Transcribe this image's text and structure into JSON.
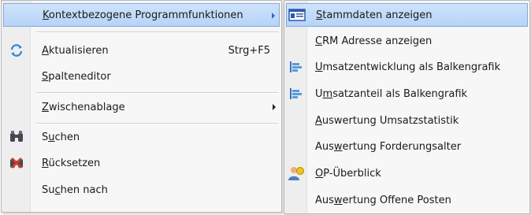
{
  "left_menu": {
    "items": [
      {
        "pre": "",
        "key": "K",
        "post": "ontextbezogene Programmfunktionen"
      },
      {
        "pre": "",
        "key": "A",
        "post": "ktualisieren",
        "shortcut": "Strg+F5",
        "icon": "refresh-icon"
      },
      {
        "pre": "",
        "key": "S",
        "post": "palteneditor"
      },
      {
        "pre": "",
        "key": "Z",
        "post": "wischenablage"
      },
      {
        "pre": "S",
        "key": "u",
        "post": "chen",
        "icon": "binoculars-icon"
      },
      {
        "pre": "",
        "key": "R",
        "post": "ücksetzen",
        "icon": "binoculars-reset-icon"
      },
      {
        "pre": "Su",
        "key": "c",
        "post": "hen nach"
      }
    ]
  },
  "right_menu": {
    "items": [
      {
        "pre": "",
        "key": "S",
        "post": "tammdaten anzeigen",
        "icon": "card-icon"
      },
      {
        "pre": "",
        "key": "C",
        "post": "RM Adresse anzeigen"
      },
      {
        "pre": "",
        "key": "U",
        "post": "msatzentwicklung als Balkengrafik",
        "icon": "bar-chart-icon"
      },
      {
        "pre": "U",
        "key": "m",
        "post": "satzanteil als Balkengrafik",
        "icon": "bar-chart-icon"
      },
      {
        "pre": "",
        "key": "A",
        "post": "uswertung Umsatzstatistik"
      },
      {
        "pre": "Aus",
        "key": "w",
        "post": "ertung Forderungsalter"
      },
      {
        "pre": "",
        "key": "O",
        "post": "P-Überblick",
        "icon": "person-money-icon"
      },
      {
        "pre": "Aus",
        "key": "w",
        "post": "ertung Offene Posten"
      }
    ]
  },
  "colors": {
    "highlight": "#b6d3f7",
    "highlight_border": "#7fa9e0",
    "accent_blue": "#3366cc"
  }
}
